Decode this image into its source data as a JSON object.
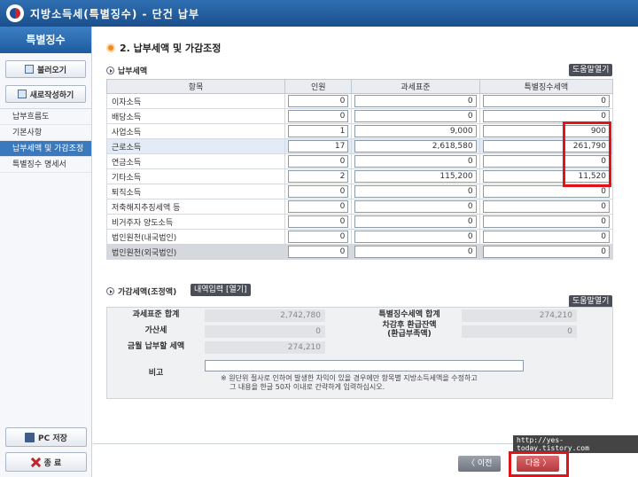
{
  "window": {
    "title": "지방소득세(특별징수) - 단건 납부"
  },
  "sidebar": {
    "header": "특별징수",
    "load_button": "불러오기",
    "new_button": "새로작성하기",
    "items": [
      "납부흐름도",
      "기본사항",
      "납부세액 및 가감조정",
      "특별징수 명세서"
    ],
    "active_index": 2,
    "save_button": "PC 저장",
    "exit_button": "종 료"
  },
  "main": {
    "section_title": "2. 납부세액 및 가감조정",
    "tax_subtitle": "납부세액",
    "help_button": "도움말열기",
    "columns": [
      "항목",
      "인원",
      "과세표준",
      "특별징수세액"
    ],
    "rows": [
      {
        "item": "이자소득",
        "people": "0",
        "base": "0",
        "tax": "0"
      },
      {
        "item": "배당소득",
        "people": "0",
        "base": "0",
        "tax": "0"
      },
      {
        "item": "사업소득",
        "people": "1",
        "base": "9,000",
        "tax": "900"
      },
      {
        "item": "근로소득",
        "people": "17",
        "base": "2,618,580",
        "tax": "261,790"
      },
      {
        "item": "연금소득",
        "people": "0",
        "base": "0",
        "tax": "0"
      },
      {
        "item": "기타소득",
        "people": "2",
        "base": "115,200",
        "tax": "11,520"
      },
      {
        "item": "퇴직소득",
        "people": "0",
        "base": "0",
        "tax": "0"
      },
      {
        "item": "저축해지추징세액 등",
        "people": "0",
        "base": "0",
        "tax": "0"
      },
      {
        "item": "비거주자 양도소득",
        "people": "0",
        "base": "0",
        "tax": "0"
      },
      {
        "item": "법인원천(내국법인)",
        "people": "0",
        "base": "0",
        "tax": "0"
      },
      {
        "item": "법인원천(외국법인)",
        "people": "0",
        "base": "0",
        "tax": "0"
      }
    ],
    "adjust_subtitle": "가감세액(조정액)",
    "detail_button": "내역입력 [열기]",
    "help_button2": "도움말열기",
    "summary": {
      "base_total_label": "과세표준 합계",
      "base_total": "2,742,780",
      "tax_total_label": "특별징수세액 합계",
      "tax_total": "274,210",
      "penalty_label": "가산세",
      "penalty": "0",
      "refund_label_1": "차감후 환급잔액",
      "refund_label_2": "(환급부족액)",
      "refund": "0",
      "pay_label": "금월 납부할 세액",
      "pay": "274,210",
      "memo_label": "비고",
      "memo_note_1": "※ 원단위 절사로 인하여 발생한 차익이 있을 경우에만 항목별 지방소득세액을 수정하고",
      "memo_note_2": "그 내용을 한글 50자 이내로 간략하게 입력하십시오."
    }
  },
  "footer": {
    "prev_button": "〈 이전",
    "next_button": "다음 〉",
    "watermark_url": "http://yes-today.tistory.com"
  }
}
